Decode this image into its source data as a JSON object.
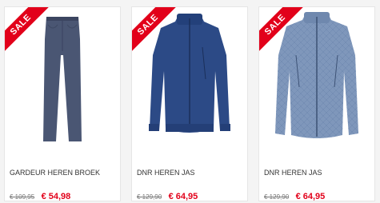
{
  "sale_label": "SALE",
  "colors": {
    "sale_red": "#e2001a",
    "card_bg": "#ffffff",
    "page_bg": "#f4f4f4"
  },
  "products": [
    {
      "name": "GARDEUR HEREN BROEK",
      "old_price": "€ 109,95",
      "new_price": "€ 54,98",
      "image": "navy-trousers"
    },
    {
      "name": "DNR HEREN JAS",
      "old_price": "€ 129,90",
      "new_price": "€ 64,95",
      "image": "blue-jacket"
    },
    {
      "name": "DNR HEREN JAS",
      "old_price": "€ 129,90",
      "new_price": "€ 64,95",
      "image": "light-blue-quilted-jacket"
    }
  ]
}
